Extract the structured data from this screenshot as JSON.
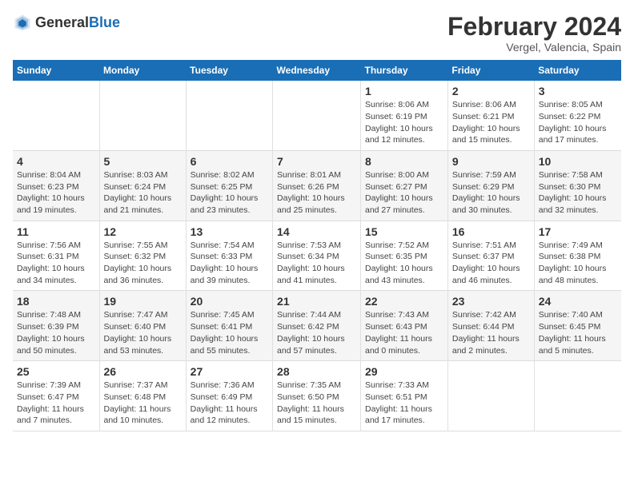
{
  "header": {
    "logo_general": "General",
    "logo_blue": "Blue",
    "title": "February 2024",
    "subtitle": "Vergel, Valencia, Spain"
  },
  "columns": [
    "Sunday",
    "Monday",
    "Tuesday",
    "Wednesday",
    "Thursday",
    "Friday",
    "Saturday"
  ],
  "weeks": [
    [
      {
        "day": "",
        "detail": ""
      },
      {
        "day": "",
        "detail": ""
      },
      {
        "day": "",
        "detail": ""
      },
      {
        "day": "",
        "detail": ""
      },
      {
        "day": "1",
        "detail": "Sunrise: 8:06 AM\nSunset: 6:19 PM\nDaylight: 10 hours\nand 12 minutes."
      },
      {
        "day": "2",
        "detail": "Sunrise: 8:06 AM\nSunset: 6:21 PM\nDaylight: 10 hours\nand 15 minutes."
      },
      {
        "day": "3",
        "detail": "Sunrise: 8:05 AM\nSunset: 6:22 PM\nDaylight: 10 hours\nand 17 minutes."
      }
    ],
    [
      {
        "day": "4",
        "detail": "Sunrise: 8:04 AM\nSunset: 6:23 PM\nDaylight: 10 hours\nand 19 minutes."
      },
      {
        "day": "5",
        "detail": "Sunrise: 8:03 AM\nSunset: 6:24 PM\nDaylight: 10 hours\nand 21 minutes."
      },
      {
        "day": "6",
        "detail": "Sunrise: 8:02 AM\nSunset: 6:25 PM\nDaylight: 10 hours\nand 23 minutes."
      },
      {
        "day": "7",
        "detail": "Sunrise: 8:01 AM\nSunset: 6:26 PM\nDaylight: 10 hours\nand 25 minutes."
      },
      {
        "day": "8",
        "detail": "Sunrise: 8:00 AM\nSunset: 6:27 PM\nDaylight: 10 hours\nand 27 minutes."
      },
      {
        "day": "9",
        "detail": "Sunrise: 7:59 AM\nSunset: 6:29 PM\nDaylight: 10 hours\nand 30 minutes."
      },
      {
        "day": "10",
        "detail": "Sunrise: 7:58 AM\nSunset: 6:30 PM\nDaylight: 10 hours\nand 32 minutes."
      }
    ],
    [
      {
        "day": "11",
        "detail": "Sunrise: 7:56 AM\nSunset: 6:31 PM\nDaylight: 10 hours\nand 34 minutes."
      },
      {
        "day": "12",
        "detail": "Sunrise: 7:55 AM\nSunset: 6:32 PM\nDaylight: 10 hours\nand 36 minutes."
      },
      {
        "day": "13",
        "detail": "Sunrise: 7:54 AM\nSunset: 6:33 PM\nDaylight: 10 hours\nand 39 minutes."
      },
      {
        "day": "14",
        "detail": "Sunrise: 7:53 AM\nSunset: 6:34 PM\nDaylight: 10 hours\nand 41 minutes."
      },
      {
        "day": "15",
        "detail": "Sunrise: 7:52 AM\nSunset: 6:35 PM\nDaylight: 10 hours\nand 43 minutes."
      },
      {
        "day": "16",
        "detail": "Sunrise: 7:51 AM\nSunset: 6:37 PM\nDaylight: 10 hours\nand 46 minutes."
      },
      {
        "day": "17",
        "detail": "Sunrise: 7:49 AM\nSunset: 6:38 PM\nDaylight: 10 hours\nand 48 minutes."
      }
    ],
    [
      {
        "day": "18",
        "detail": "Sunrise: 7:48 AM\nSunset: 6:39 PM\nDaylight: 10 hours\nand 50 minutes."
      },
      {
        "day": "19",
        "detail": "Sunrise: 7:47 AM\nSunset: 6:40 PM\nDaylight: 10 hours\nand 53 minutes."
      },
      {
        "day": "20",
        "detail": "Sunrise: 7:45 AM\nSunset: 6:41 PM\nDaylight: 10 hours\nand 55 minutes."
      },
      {
        "day": "21",
        "detail": "Sunrise: 7:44 AM\nSunset: 6:42 PM\nDaylight: 10 hours\nand 57 minutes."
      },
      {
        "day": "22",
        "detail": "Sunrise: 7:43 AM\nSunset: 6:43 PM\nDaylight: 11 hours\nand 0 minutes."
      },
      {
        "day": "23",
        "detail": "Sunrise: 7:42 AM\nSunset: 6:44 PM\nDaylight: 11 hours\nand 2 minutes."
      },
      {
        "day": "24",
        "detail": "Sunrise: 7:40 AM\nSunset: 6:45 PM\nDaylight: 11 hours\nand 5 minutes."
      }
    ],
    [
      {
        "day": "25",
        "detail": "Sunrise: 7:39 AM\nSunset: 6:47 PM\nDaylight: 11 hours\nand 7 minutes."
      },
      {
        "day": "26",
        "detail": "Sunrise: 7:37 AM\nSunset: 6:48 PM\nDaylight: 11 hours\nand 10 minutes."
      },
      {
        "day": "27",
        "detail": "Sunrise: 7:36 AM\nSunset: 6:49 PM\nDaylight: 11 hours\nand 12 minutes."
      },
      {
        "day": "28",
        "detail": "Sunrise: 7:35 AM\nSunset: 6:50 PM\nDaylight: 11 hours\nand 15 minutes."
      },
      {
        "day": "29",
        "detail": "Sunrise: 7:33 AM\nSunset: 6:51 PM\nDaylight: 11 hours\nand 17 minutes."
      },
      {
        "day": "",
        "detail": ""
      },
      {
        "day": "",
        "detail": ""
      }
    ]
  ]
}
